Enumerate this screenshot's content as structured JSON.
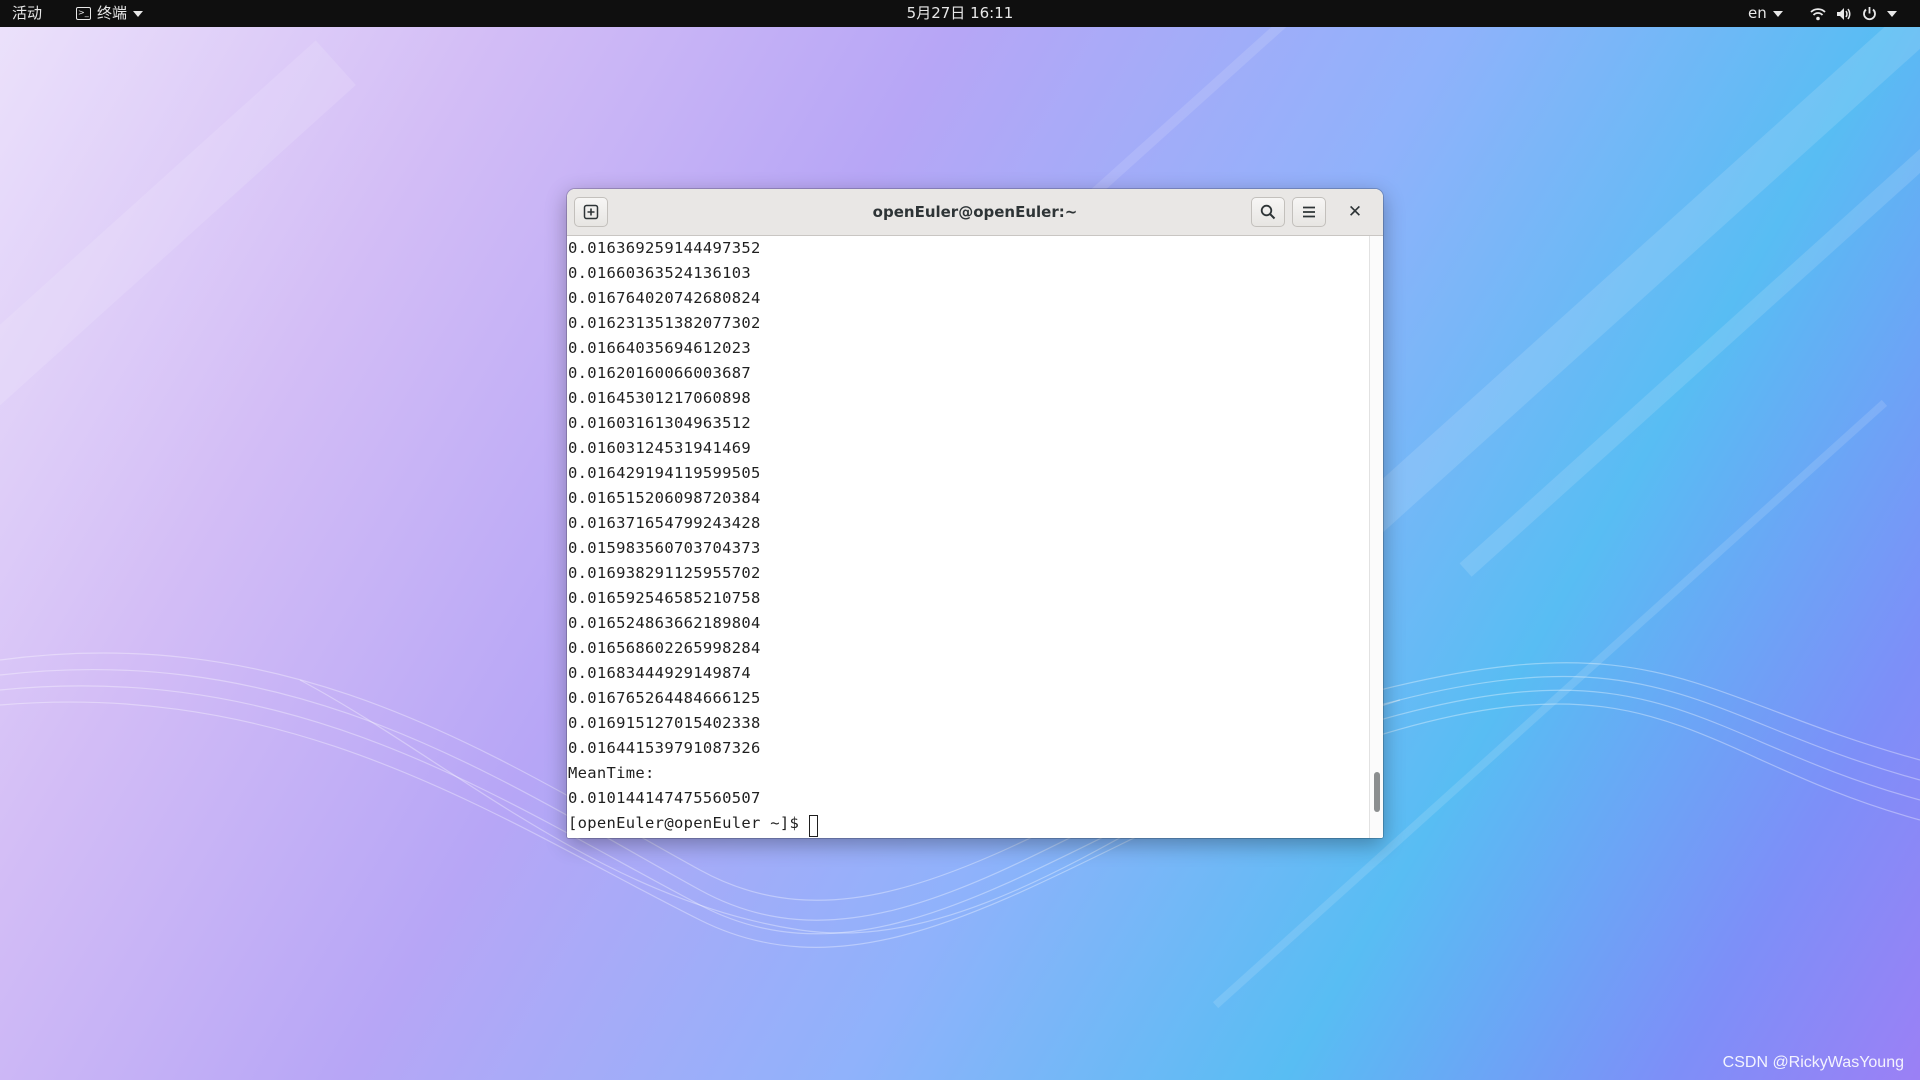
{
  "topbar": {
    "activities": "活动",
    "app_name": "终端",
    "clock": "5月27日  16:11",
    "language": "en"
  },
  "window": {
    "title": "openEuler@openEuler:~",
    "lines": [
      "0.016369259144497352",
      "0.01660363524136103",
      "0.016764020742680824",
      "0.016231351382077302",
      "0.01664035694612023",
      "0.01620160066003687",
      "0.01645301217060898",
      "0.01603161304963512",
      "0.01603124531941469",
      "0.016429194119599505",
      "0.016515206098720384",
      "0.016371654799243428",
      "0.015983560703704373",
      "0.016938291125955702",
      "0.016592546585210758",
      "0.016524863662189804",
      "0.016568602265998284",
      "0.01683444929149874",
      "0.016765264484666125",
      "0.016915127015402338",
      "0.016441539791087326",
      "MeanTime:",
      "0.010144147475560507"
    ],
    "prompt": "[openEuler@openEuler ~]$",
    "scroll_position": 0.96
  },
  "watermark": "CSDN @RickyWasYoung",
  "icons": {
    "terminal": "terminal-icon",
    "new_tab": "new-tab-icon",
    "search": "search-icon",
    "menu": "hamburger-menu-icon",
    "close": "close-icon",
    "wifi": "wifi-icon",
    "volume": "volume-icon",
    "power": "power-icon"
  }
}
